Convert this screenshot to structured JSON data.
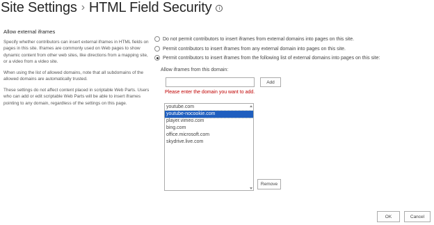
{
  "header": {
    "breadcrumb_root": "Site Settings",
    "separator": "›",
    "page_title": "HTML Field Security",
    "info_icon_glyph": "i"
  },
  "left": {
    "section_heading": "Allow external iframes",
    "paragraph_1": "Specify whether contributors can insert external iframes in HTML fields on pages in this site. Iframes are commonly used on Web pages to show dynamic content from other web sites, like directions from a mapping site, or a video from a video site.",
    "paragraph_2": "When using the list of allowed domains, note that all subdomains of the allowed domains are automatically trusted.",
    "paragraph_3": "These settings do not affect content placed in scriptable Web Parts. Users who can add or edit scriptable Web Parts will be able to insert iframes pointing to any domain, regardless of the settings on this page."
  },
  "options": {
    "selected_index": 2,
    "items": [
      {
        "label": "Do not permit contributors to insert iframes from external domains into pages on this site."
      },
      {
        "label": "Permit contributors to insert iframes from any external domain into pages on this site."
      },
      {
        "label": "Permit contributors to insert iframes from the following list of external domains into pages on this site:"
      }
    ]
  },
  "domain_form": {
    "allow_label": "Allow iframes from this domain:",
    "input_value": "",
    "add_label": "Add",
    "error_message": "Please enter the domain you want to add.",
    "selected_domain": "youtube-nocookie.com",
    "domains": [
      "youtube.com",
      "youtube-nocookie.com",
      "player.vimeo.com",
      "bing.com",
      "office.microsoft.com",
      "skydrive.live.com"
    ],
    "remove_label": "Remove"
  },
  "footer": {
    "ok_label": "OK",
    "cancel_label": "Cancel"
  },
  "colors": {
    "selection": "#1f5fbf",
    "error": "#bf0000"
  }
}
